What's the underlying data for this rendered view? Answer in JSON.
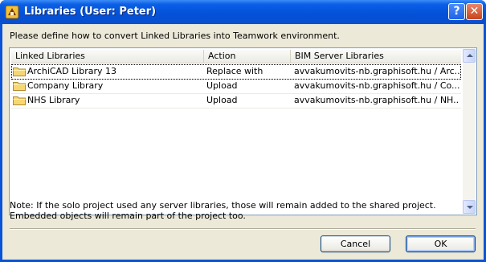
{
  "window": {
    "title": "Libraries (User: Peter)",
    "help_label": "?",
    "close_label": "✕"
  },
  "instruction": "Please define how to convert Linked Libraries into Teamwork environment.",
  "table": {
    "columns": [
      "Linked Libraries",
      "Action",
      "BIM Server Libraries"
    ],
    "rows": [
      {
        "library": "ArchiCAD Library 13",
        "action": "Replace with",
        "server": "avvakumovits-nb.graphisoft.hu / Arc..."
      },
      {
        "library": "Company Library",
        "action": "Upload",
        "server": "avvakumovits-nb.graphisoft.hu / Co..."
      },
      {
        "library": "NHS Library",
        "action": "Upload",
        "server": "avvakumovits-nb.graphisoft.hu / NH..."
      }
    ]
  },
  "note": "Note: If the solo project used any server libraries, those will remain added to the shared project. Embedded objects will remain part of the project too.",
  "buttons": {
    "cancel": "Cancel",
    "ok": "OK"
  },
  "icons": {
    "app": "archicad-app-icon",
    "folder": "folder-icon"
  },
  "colors": {
    "titlebar": "#0450d6",
    "dialog_bg": "#ece9d8",
    "list_border": "#7f9db9"
  }
}
